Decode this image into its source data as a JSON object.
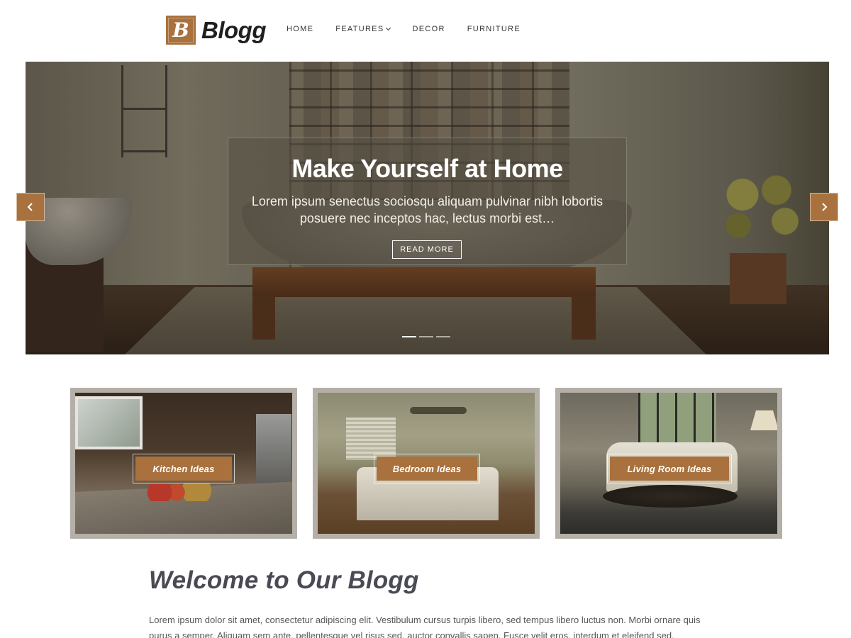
{
  "brand": {
    "logo_letter": "B",
    "name": "Blogg",
    "accent": "#a9713d"
  },
  "nav": {
    "items": [
      {
        "label": "HOME"
      },
      {
        "label": "FEATURES",
        "has_dropdown": true
      },
      {
        "label": "DECOR"
      },
      {
        "label": "FURNITURE"
      }
    ]
  },
  "slider": {
    "title": "Make Yourself at Home",
    "excerpt": "Lorem ipsum senectus sociosqu aliquam pulvinar nibh lobortis posuere nec inceptos hac, lectus morbi est…",
    "button_label": "READ MORE",
    "prev_icon": "chevron-left-icon",
    "next_icon": "chevron-right-icon",
    "dots": {
      "count": 3,
      "active": 0
    }
  },
  "cards": [
    {
      "label": "Kitchen Ideas"
    },
    {
      "label": "Bedroom Ideas"
    },
    {
      "label": "Living Room Ideas"
    }
  ],
  "welcome": {
    "title": "Welcome to Our Blogg",
    "body": "Lorem ipsum dolor sit amet, consectetur adipiscing elit. Vestibulum cursus turpis libero, sed tempus libero luctus non. Morbi ornare quis purus a semper. Aliquam sem ante, pellentesque vel risus sed, auctor convallis sapen. Fusce velit eros, interdum et eleifend sed, elementum in eros."
  }
}
